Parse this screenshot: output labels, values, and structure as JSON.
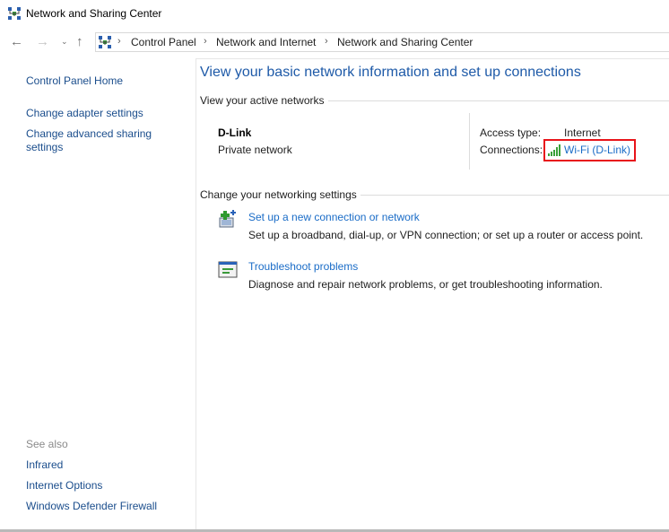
{
  "window": {
    "title": "Network and Sharing Center"
  },
  "nav": {
    "back": "←",
    "forward": "→",
    "recent": "⌄",
    "up": "↑"
  },
  "breadcrumb": {
    "sep": "›",
    "items": [
      "Control Panel",
      "Network and Internet",
      "Network and Sharing Center"
    ]
  },
  "sidebar": {
    "home": "Control Panel Home",
    "links": [
      "Change adapter settings",
      "Change advanced sharing settings"
    ],
    "see_also_label": "See also",
    "see_also": [
      "Infrared",
      "Internet Options",
      "Windows Defender Firewall"
    ]
  },
  "main": {
    "heading": "View your basic network information and set up connections",
    "active_title": "View your active networks",
    "network": {
      "name": "D-Link",
      "type": "Private network",
      "access_label": "Access type:",
      "access_value": "Internet",
      "connections_label": "Connections:",
      "connection_link": "Wi-Fi (D-Link)"
    },
    "change_title": "Change your networking settings",
    "tasks": [
      {
        "link": "Set up a new connection or network",
        "desc": "Set up a broadband, dial-up, or VPN connection; or set up a router or access point.",
        "icon": "new-connection-icon"
      },
      {
        "link": "Troubleshoot problems",
        "desc": "Diagnose and repair network problems, or get troubleshooting information.",
        "icon": "troubleshoot-icon"
      }
    ]
  },
  "colors": {
    "link": "#1a6cc7",
    "heading": "#1e5aa8",
    "highlight": "#e8141a"
  }
}
